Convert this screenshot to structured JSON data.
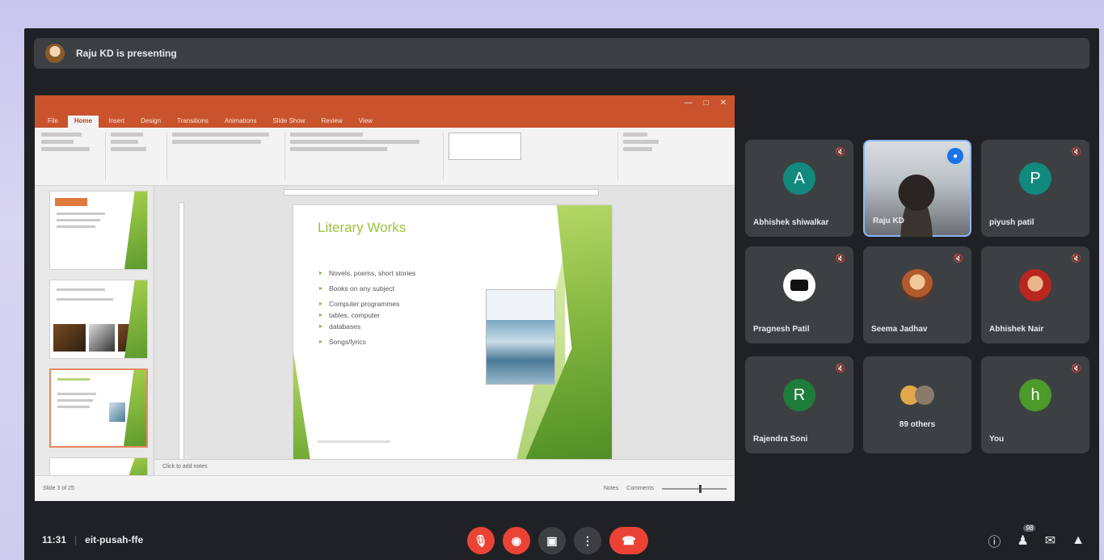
{
  "presenter": {
    "text": "Raju KD is presenting"
  },
  "powerpoint": {
    "tabs": [
      "File",
      "Home",
      "Insert",
      "Design",
      "Transitions",
      "Animations",
      "Slide Show",
      "Review",
      "View"
    ],
    "slide": {
      "title": "Literary Works",
      "bullets": [
        "Novels, poems, short stories",
        "Books on any subject",
        "Computer programmes",
        "tables, computer",
        "databases",
        "Songs/lyrics"
      ]
    },
    "notes_placeholder": "Click to add notes",
    "status_left": "Slide 3 of 25",
    "status_right": [
      "Notes",
      "Comments"
    ]
  },
  "participants": [
    {
      "name": "Abhishek shiwalkar",
      "initial": "A",
      "color": "#12897d",
      "kind": "initial"
    },
    {
      "name": "Raju KD",
      "kind": "video",
      "speaking": true
    },
    {
      "name": "piyush patil",
      "initial": "P",
      "color": "#12897d",
      "kind": "initial"
    },
    {
      "name": "Pragnesh Patil",
      "kind": "logo"
    },
    {
      "name": "Seema Jadhav",
      "kind": "photo"
    },
    {
      "name": "Abhishek Nair",
      "kind": "photo2"
    },
    {
      "name": "Rajendra Soni",
      "initial": "R",
      "color": "#1e7d3b",
      "kind": "initial"
    },
    {
      "name": "89 others",
      "kind": "group"
    },
    {
      "name": "You",
      "initial": "h",
      "color": "#4c9a2a",
      "kind": "initial"
    }
  ],
  "meeting": {
    "time": "11:31",
    "code": "eit-pusah-ffe"
  },
  "controls": [
    "mic-off",
    "camera-off",
    "present",
    "more-options",
    "leave-call"
  ],
  "people_count": "98"
}
